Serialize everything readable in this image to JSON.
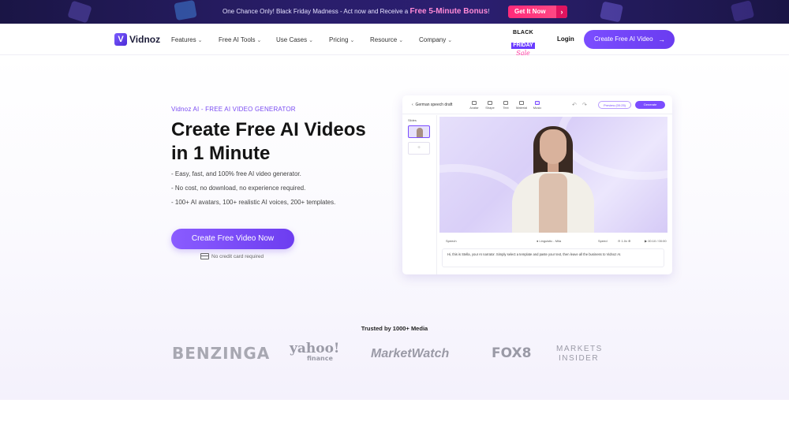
{
  "promo": {
    "text": "One Chance Only! Black Friday Madness - Act now and Receive a ",
    "highlight": "Free 5-Minute Bonus",
    "suffix": "!",
    "cta": "Get It Now",
    "cta_arrow": "›"
  },
  "nav": {
    "logo_mark": "V",
    "logo_name": "Vidnoz",
    "items": [
      {
        "label": "Features"
      },
      {
        "label": "Free AI Tools"
      },
      {
        "label": "Use Cases"
      },
      {
        "label": "Pricing"
      },
      {
        "label": "Resource"
      },
      {
        "label": "Company"
      }
    ],
    "chevron": "⌄",
    "black_friday": {
      "l1": "BLACK",
      "l2": "FRIDAY",
      "l3": "Sale"
    },
    "login": "Login",
    "cta": "Create Free AI Video",
    "cta_arrow": "→"
  },
  "hero": {
    "eyebrow": "Vidnoz AI - FREE AI VIDEO GENERATOR",
    "title_line1": "Create Free AI Videos",
    "title_line2": "in 1 Minute",
    "bullets": [
      "- Easy, fast, and 100% free AI video generator.",
      "- No cost, no download, no experience required.",
      "- 100+ AI avatars, 100+ realistic AI voices, 200+ templates."
    ],
    "cta": "Create Free Video Now",
    "note": "No credit card required"
  },
  "editor": {
    "back_label": "German speech draft",
    "tools": [
      "Avatar",
      "Shape",
      "Text",
      "Material",
      "Music"
    ],
    "preview": "Preview (00:25)",
    "generate": "Generate",
    "side_label": "Slides",
    "add": "+",
    "speech_label": "Speech",
    "voice": "Linguistic - Mila",
    "speed_label": "Speed",
    "speed": "1.0x",
    "duration": "00:10 / 00:00",
    "script": "Hi, this is Stella, your AI narrator. Simply select a template and paste your text, then leave all the business to Vidnoz AI."
  },
  "trusted": {
    "label": "Trusted by 1000+ Media",
    "logos": {
      "benzinga": "BENZINGA",
      "yahoo": "yahoo!",
      "yahoo_sub": "finance",
      "marketwatch": "MarketWatch",
      "fox": "FOX8",
      "markets_insider_1": "MARKETS",
      "markets_insider_2": "INSIDER"
    }
  }
}
